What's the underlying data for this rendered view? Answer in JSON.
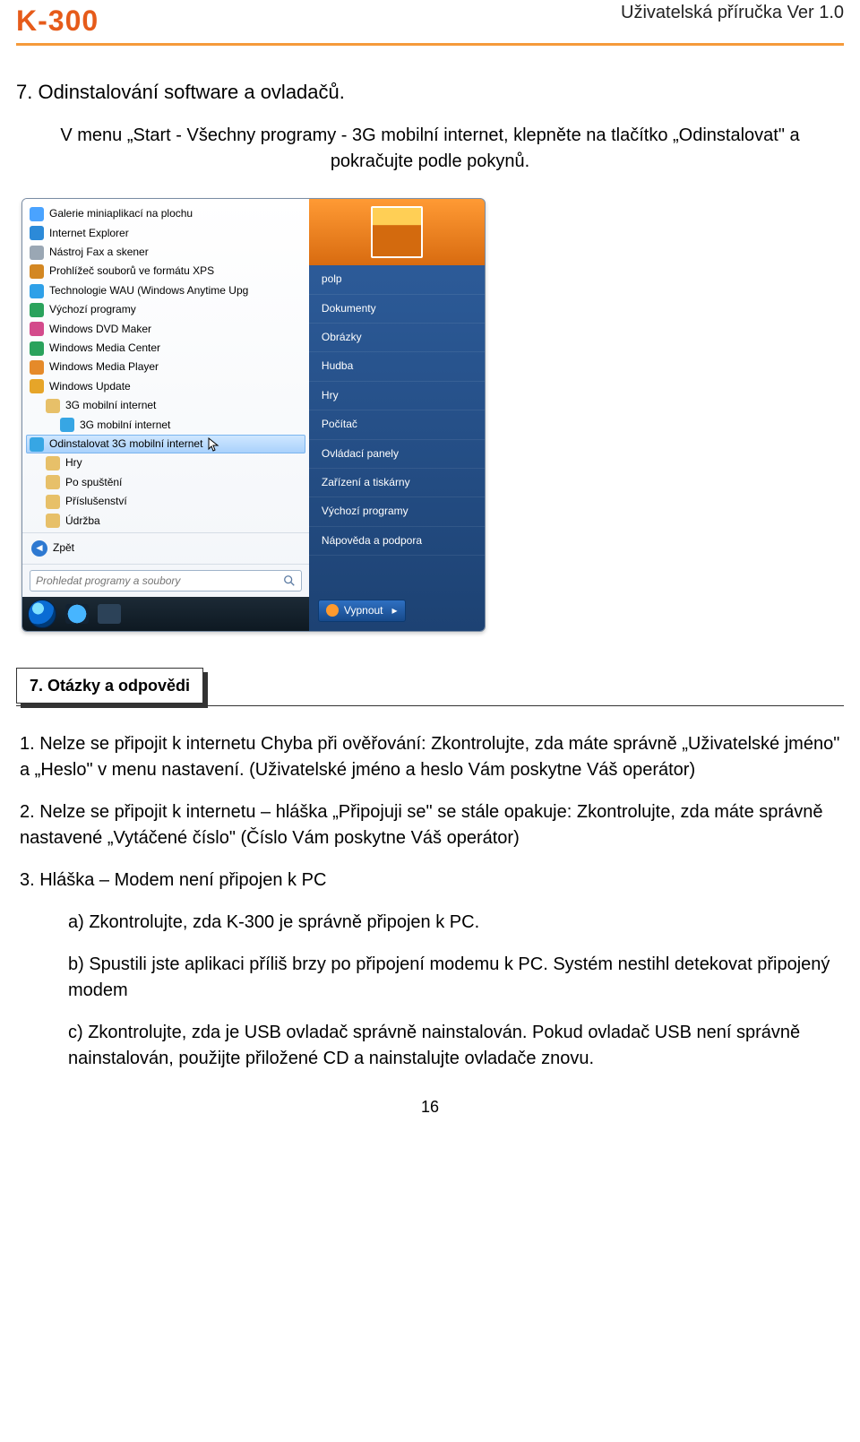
{
  "header": {
    "brand": "K-300",
    "version": "Uživatelská příručka Ver 1.0"
  },
  "section7": {
    "title": "7. Odinstalování software a ovladačů.",
    "text": "V menu „Start - Všechny programy - 3G mobilní internet, klepněte na tlačítko „Odinstalovat\" a pokračujte podle pokynů."
  },
  "startmenu": {
    "apps": [
      {
        "label": "Galerie miniaplikací na plochu",
        "ico": "#4aa3ff"
      },
      {
        "label": "Internet Explorer",
        "ico": "#2c8ad8"
      },
      {
        "label": "Nástroj Fax a skener",
        "ico": "#9aa7b4"
      },
      {
        "label": "Prohlížeč souborů ve formátu XPS",
        "ico": "#d38722"
      },
      {
        "label": "Technologie WAU (Windows Anytime Upg",
        "ico": "#2ea0e8"
      },
      {
        "label": "Výchozí programy",
        "ico": "#2aa25c"
      },
      {
        "label": "Windows DVD Maker",
        "ico": "#d34a8b"
      },
      {
        "label": "Windows Media Center",
        "ico": "#2aa25c"
      },
      {
        "label": "Windows Media Player",
        "ico": "#e58a2a"
      },
      {
        "label": "Windows Update",
        "ico": "#e6a529"
      },
      {
        "label": "3G mobilní internet",
        "ico": "#e7c069",
        "sub": true
      },
      {
        "label": "3G mobilní internet",
        "ico": "#37a6e4",
        "sub2": true
      },
      {
        "label": "Odinstalovat 3G mobilní internet",
        "ico": "#37a6e4",
        "sub2": true,
        "selected": true
      },
      {
        "label": "Hry",
        "ico": "#e7c069",
        "sub": true
      },
      {
        "label": "Po spuštění",
        "ico": "#e7c069",
        "sub": true
      },
      {
        "label": "Příslušenství",
        "ico": "#e7c069",
        "sub": true
      },
      {
        "label": "Údržba",
        "ico": "#e7c069",
        "sub": true
      }
    ],
    "back": "Zpět",
    "search_placeholder": "Prohledat programy a soubory",
    "right": {
      "user": "polp",
      "categories": [
        "Dokumenty",
        "Obrázky",
        "Hudba",
        "Hry",
        "Počítač",
        "Ovládací panely",
        "Zařízení a tiskárny",
        "Výchozí programy",
        "Nápověda a podpora"
      ],
      "shutdown": "Vypnout"
    }
  },
  "qa": {
    "title": "7. Otázky a odpovědi",
    "q1": "1. Nelze se připojit k internetu Chyba při ověřování: Zkontrolujte, zda máte správně „Uživatelské jméno\" a „Heslo\" v menu nastavení. (Uživatelské jméno a heslo Vám poskytne Váš operátor)",
    "q2": "2. Nelze se připojit k internetu – hláška „Připojuji se\" se stále opakuje: Zkontrolujte, zda máte správně nastavené „Vytáčené číslo\" (Číslo Vám poskytne Váš operátor)",
    "q3": "3. Hláška – Modem není připojen k PC",
    "q3a": "a) Zkontrolujte, zda K-300 je správně připojen k PC.",
    "q3b": "b) Spustili jste aplikaci příliš brzy po připojení modemu k PC. Systém nestihl detekovat připojený modem",
    "q3c": "c) Zkontrolujte, zda je USB ovladač správně nainstalován. Pokud ovladač USB není správně nainstalován, použijte přiložené CD a nainstalujte ovladače znovu."
  },
  "pagenum": "16"
}
